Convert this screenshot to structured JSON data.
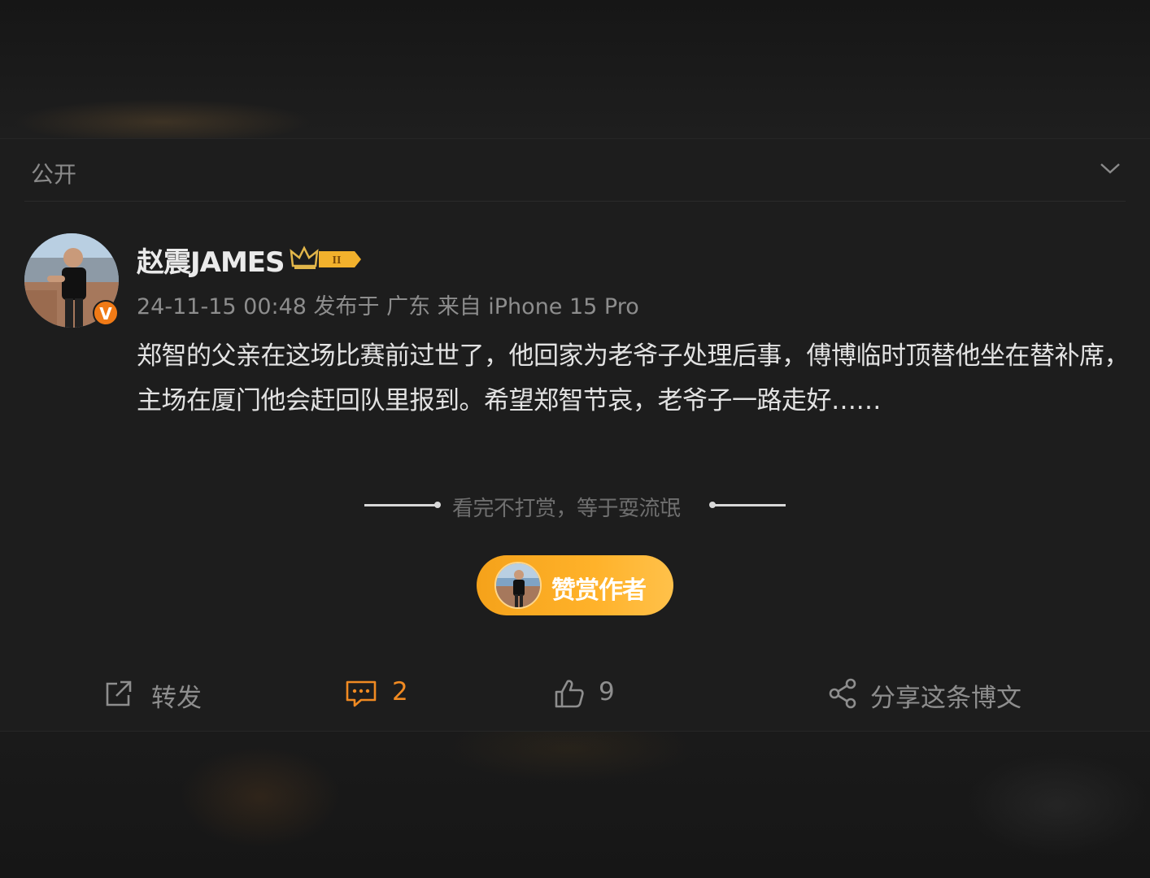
{
  "post": {
    "visibility": "公开",
    "author": "赵震JAMES",
    "verified_badge": "V",
    "vip_badge_text": "II",
    "meta": "24-11-15 00:48 发布于 广东 来自 iPhone 15 Pro",
    "content": "郑智的父亲在这场比赛前过世了，他回家为老爷子处理后事，傅博临时顶替他坐在替补席，主场在厦门他会赶回队里报到。希望郑智节哀，老爷子一路走好……"
  },
  "reward": {
    "tip_text": "看完不打赏，等于耍流氓",
    "button_label": "赞赏作者"
  },
  "actions": {
    "repost_label": "转发",
    "comment_count": "2",
    "like_count": "9",
    "share_label": "分享这条博文"
  },
  "icons": {
    "chevron": "chevron-down-icon",
    "repost": "repost-icon",
    "comment": "comment-icon",
    "like": "thumbs-up-icon",
    "share": "share-icon"
  },
  "colors": {
    "accent": "#f08a22",
    "reward_button": "#ffb22a",
    "badge": "#f07a16"
  }
}
